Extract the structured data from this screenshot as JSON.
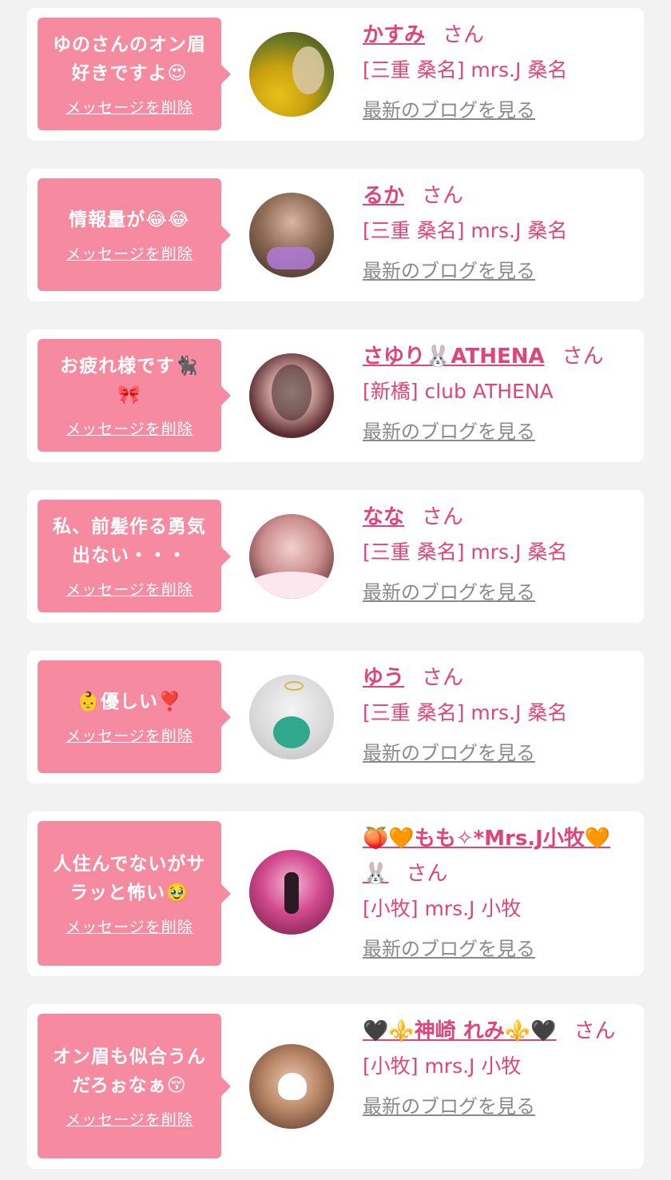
{
  "delete_label": "メッセージを削除",
  "blog_label": "最新のブログを見る",
  "honorific": "さん",
  "colors": {
    "accent": "#e0457a",
    "bubble": "#f58aa0",
    "link_gray": "#8a8a8a",
    "background": "#f2f2f2"
  },
  "entries": [
    {
      "message_lines": [
        "ゆのさんのオン眉",
        "好きですよ😍"
      ],
      "name": "かすみ",
      "shop": "[三重 桑名] mrs.J 桑名",
      "avatar": "photo-avatar"
    },
    {
      "message_lines": [
        "情報量が😂😂"
      ],
      "name": "るか",
      "shop": "[三重 桑名] mrs.J 桑名",
      "avatar": "photo-avatar"
    },
    {
      "message_lines": [
        "お疲れ様です🐈‍⬛",
        "🎀"
      ],
      "name": "さゆり🐰ATHENA",
      "shop": "[新橋] club ATHENA",
      "avatar": "photo-avatar"
    },
    {
      "message_lines": [
        "私、前髪作る勇気",
        "出ない・・・"
      ],
      "name": "なな",
      "shop": "[三重 桑名] mrs.J 桑名",
      "avatar": "photo-avatar"
    },
    {
      "message_lines": [
        "👶優しい❣️"
      ],
      "name": "ゆう",
      "shop": "[三重 桑名] mrs.J 桑名",
      "avatar": "photo-avatar"
    },
    {
      "message_lines": [
        "人住んでないがサ",
        "ラッと怖い🥹"
      ],
      "name": "🍑🧡もも✧*Mrs.J小牧🧡🐰",
      "shop": "[小牧] mrs.J 小牧",
      "avatar": "photo-avatar"
    },
    {
      "message_lines": [
        "オン眉も似合うん",
        "だろぉなぁ😚"
      ],
      "name": "🖤⚜️神崎 れみ⚜️🖤",
      "shop": "[小牧] mrs.J 小牧",
      "avatar": "photo-avatar"
    }
  ]
}
